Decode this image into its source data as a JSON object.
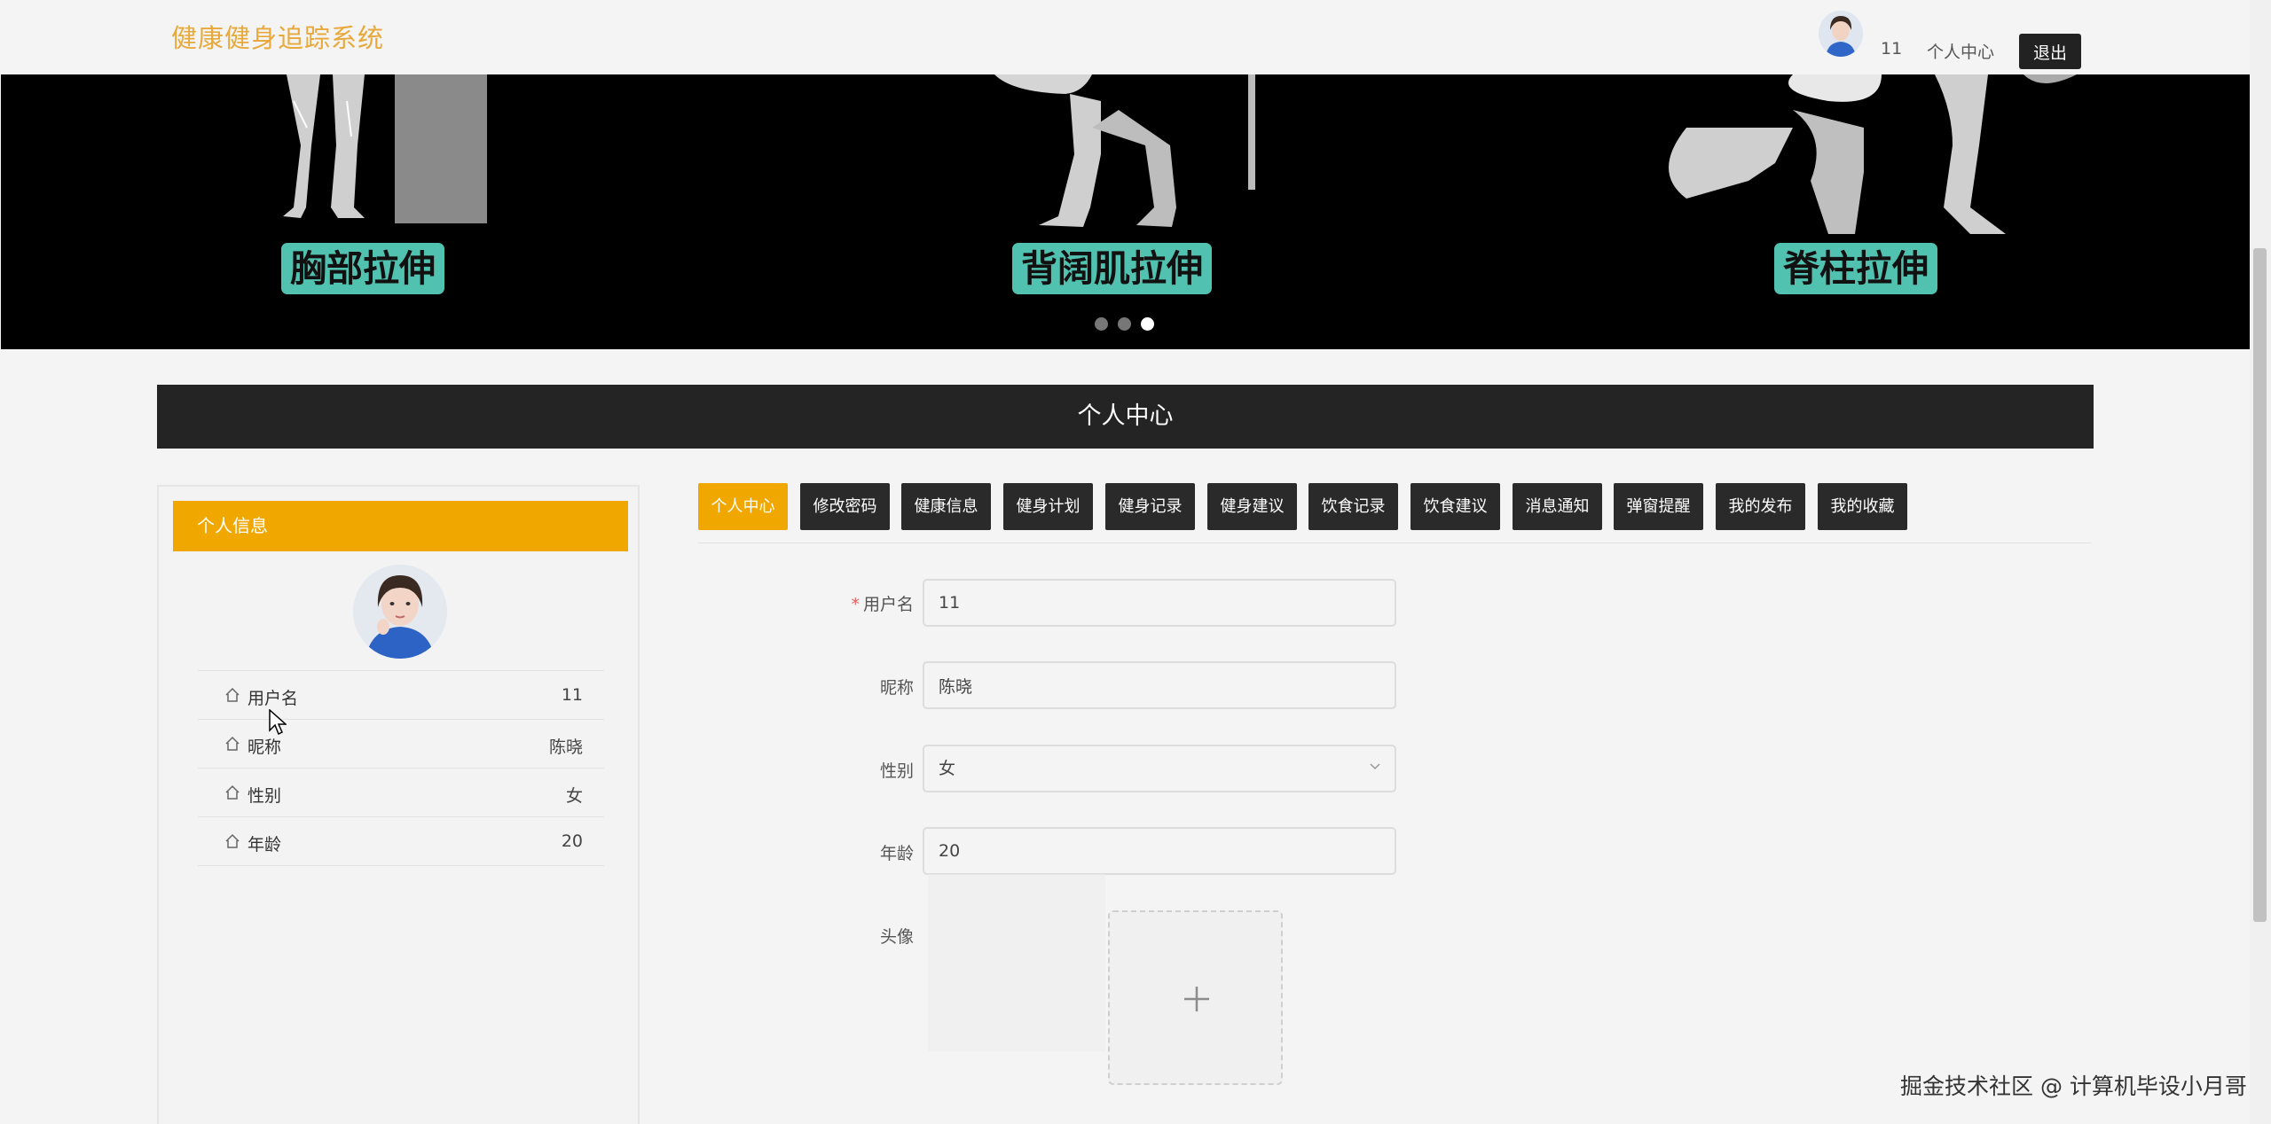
{
  "header": {
    "brand": "健康健身追踪系统",
    "username": "11",
    "personal_center": "个人中心",
    "logout": "退出"
  },
  "banner": {
    "exercises": [
      "胸部拉伸",
      "背阔肌拉伸",
      "脊柱拉伸"
    ],
    "active_slide": 3,
    "slide_count": 3
  },
  "page_title": "个人中心",
  "profile_card": {
    "title": "个人信息",
    "rows": [
      {
        "label": "用户名",
        "value": "11"
      },
      {
        "label": "昵称",
        "value": "陈晓"
      },
      {
        "label": "性别",
        "value": "女"
      },
      {
        "label": "年龄",
        "value": "20"
      }
    ]
  },
  "tabs": [
    {
      "label": "个人中心",
      "active": true
    },
    {
      "label": "修改密码"
    },
    {
      "label": "健康信息"
    },
    {
      "label": "健身计划"
    },
    {
      "label": "健身记录"
    },
    {
      "label": "健身建议"
    },
    {
      "label": "饮食记录"
    },
    {
      "label": "饮食建议"
    },
    {
      "label": "消息通知"
    },
    {
      "label": "弹窗提醒"
    },
    {
      "label": "我的发布"
    },
    {
      "label": "我的收藏"
    }
  ],
  "form": {
    "username_label": "用户名",
    "username_value": "11",
    "nickname_label": "昵称",
    "nickname_value": "陈晓",
    "gender_label": "性别",
    "gender_value": "女",
    "age_label": "年龄",
    "age_value": "20",
    "avatar_label": "头像",
    "required_mark": "*"
  },
  "watermark": "掘金技术社区 @ 计算机毕设小月哥",
  "colors": {
    "accent": "#f0a800",
    "brand": "#e8a83a",
    "dark": "#242424",
    "banner_label": "#52c2b0"
  }
}
